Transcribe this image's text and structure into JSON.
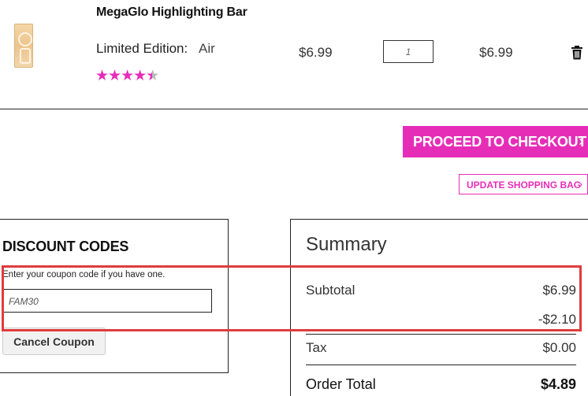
{
  "product": {
    "name": "MegaGlo Highlighting Bar",
    "variant_label": "Limited Edition:",
    "variant_value": "Air",
    "rating": 4.5,
    "rating_max": 5,
    "price": "$6.99",
    "quantity": "1",
    "line_total": "$6.99",
    "icons": {
      "thumbnail": "product-thumbnail",
      "remove": "trash-icon",
      "star": "star-icon"
    }
  },
  "actions": {
    "checkout_label": "PROCEED TO CHECKOUT",
    "update_label": "UPDATE SHOPPING BAG",
    "chevron": "›"
  },
  "discount": {
    "title": "DISCOUNT CODES",
    "hint": "Enter your coupon code if you have one.",
    "coupon_value": "FAM30",
    "cancel_label": "Cancel Coupon"
  },
  "summary": {
    "title": "Summary",
    "subtotal_label": "Subtotal",
    "subtotal_value": "$6.99",
    "discount_value": "-$2.10",
    "tax_label": "Tax",
    "tax_value": "$0.00",
    "total_label": "Order Total",
    "total_value": "$4.89"
  },
  "colors": {
    "accent": "#e62db8",
    "highlight": "#e03c3c",
    "star_off": "#b9b9b9"
  }
}
